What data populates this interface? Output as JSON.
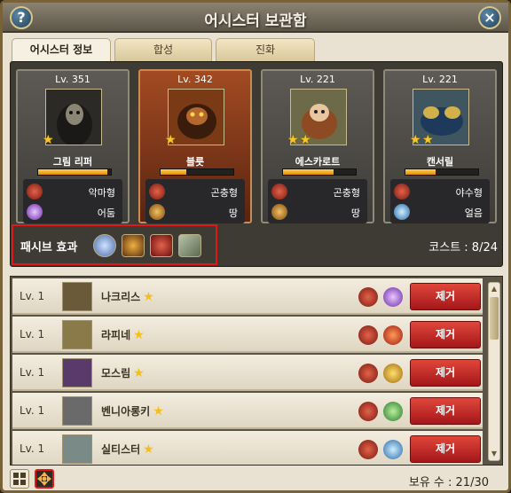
{
  "window": {
    "title": "어시스터 보관함",
    "help_label": "?",
    "close_label": "×"
  },
  "tabs": [
    {
      "label": "어시스터 정보",
      "active": true
    },
    {
      "label": "합성",
      "active": false
    },
    {
      "label": "진화",
      "active": false
    }
  ],
  "equipped": [
    {
      "level": "Lv. 351",
      "name": "그림 리퍼",
      "stars": 1,
      "exp": 0.95,
      "type": "악마형",
      "element": "어둠",
      "portrait_color": "#2c2a26",
      "type_icon": "demon-icon",
      "element_icon": "dark-element-icon"
    },
    {
      "level": "Lv. 342",
      "name": "블릇",
      "stars": 1,
      "exp": 0.35,
      "type": "곤충형",
      "element": "땅",
      "portrait_color": "#7a3a16",
      "type_icon": "insect-icon",
      "element_icon": "earth-element-icon"
    },
    {
      "level": "Lv. 221",
      "name": "에스카로트",
      "stars": 2,
      "exp": 0.7,
      "type": "곤충형",
      "element": "땅",
      "portrait_color": "#6c6a48",
      "type_icon": "insect-icon",
      "element_icon": "earth-element-icon"
    },
    {
      "level": "Lv. 221",
      "name": "캔서릴",
      "stars": 2,
      "exp": 0.42,
      "type": "야수형",
      "element": "얼음",
      "portrait_color": "#3f5560",
      "type_icon": "beast-icon",
      "element_icon": "ice-element-icon"
    }
  ],
  "passive": {
    "label": "패시브 효과",
    "icons": [
      "hexagram-icon",
      "earth-orb-icon",
      "insect-emblem-icon",
      "scroll-icon"
    ]
  },
  "cost": "코스트 : 8/24",
  "list": [
    {
      "level": "Lv. 1",
      "name": "나크리스",
      "type_icon": "insect-icon",
      "element_icon": "dark-element-icon",
      "remove": "제거",
      "portrait_color": "#6b5a3a"
    },
    {
      "level": "Lv. 1",
      "name": "라피네",
      "type_icon": "insect-icon",
      "element_icon": "fire-element-icon",
      "remove": "제거",
      "portrait_color": "#8a7a4a"
    },
    {
      "level": "Lv. 1",
      "name": "모스림",
      "type_icon": "insect-icon",
      "element_icon": "lightning-element-icon",
      "remove": "제거",
      "portrait_color": "#5a3a6a"
    },
    {
      "level": "Lv. 1",
      "name": "벤니아롱키",
      "type_icon": "demon-icon",
      "element_icon": "poison-element-icon",
      "remove": "제거",
      "portrait_color": "#6a6a6a"
    },
    {
      "level": "Lv. 1",
      "name": "실티스터",
      "type_icon": "insect-icon",
      "element_icon": "ice-element-icon",
      "remove": "제거",
      "portrait_color": "#7a8a86"
    }
  ],
  "footer": {
    "count": "보유 수 : 21/30"
  },
  "colors": {
    "accent_red": "#c41f1f",
    "exp_bar": "#f0a020",
    "star": "#f7c62e"
  }
}
